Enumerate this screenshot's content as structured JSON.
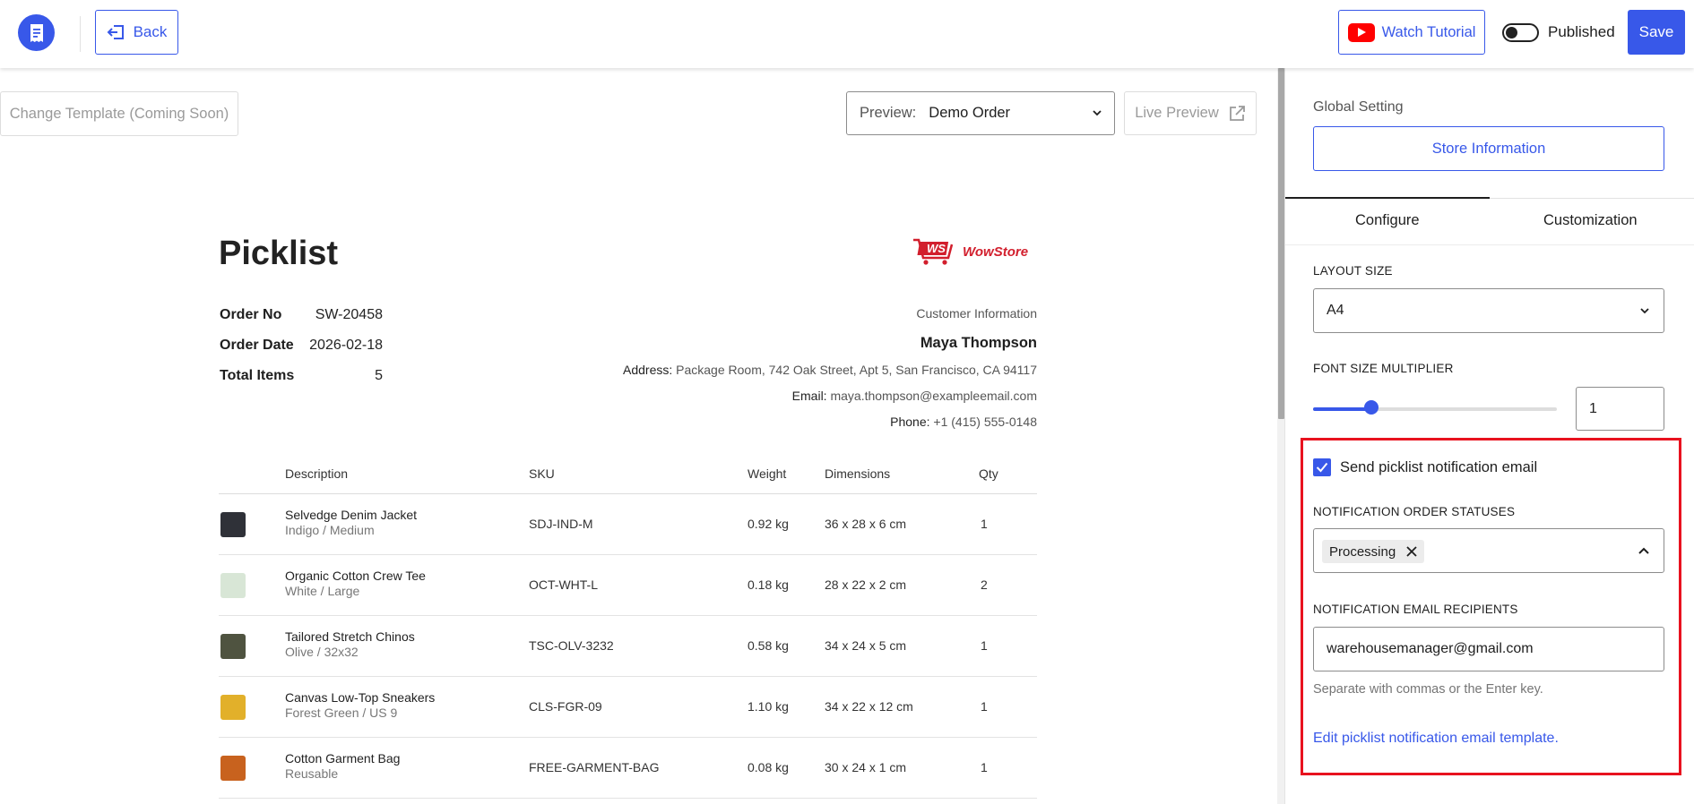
{
  "header": {
    "back_label": "Back",
    "watch_label": "Watch Tutorial",
    "published_label": "Published",
    "published_on": false,
    "save_label": "Save"
  },
  "toolbar": {
    "change_template_label": "Change Template (Coming Soon)",
    "preview_label": "Preview:",
    "preview_value": "Demo Order",
    "live_preview_label": "Live Preview"
  },
  "document": {
    "title": "Picklist",
    "brand_name": "WowStore",
    "brand_initials": "WS",
    "order": {
      "order_no_label": "Order No",
      "order_no": "SW-20458",
      "order_date_label": "Order Date",
      "order_date": "2026-02-18",
      "total_items_label": "Total Items",
      "total_items": "5"
    },
    "customer": {
      "heading": "Customer Information",
      "name": "Maya Thompson",
      "address_label": "Address:",
      "address": "Package Room, 742 Oak Street, Apt 5, San Francisco, CA 94117",
      "email_label": "Email:",
      "email": "maya.thompson@exampleemail.com",
      "phone_label": "Phone:",
      "phone": "+1 (415) 555-0148"
    },
    "table": {
      "headers": {
        "description": "Description",
        "sku": "SKU",
        "weight": "Weight",
        "dimensions": "Dimensions",
        "qty": "Qty"
      },
      "rows": [
        {
          "name": "Selvedge Denim Jacket",
          "variant": "Indigo / Medium",
          "sku": "SDJ-IND-M",
          "weight": "0.92 kg",
          "dimensions": "36 x 28 x 6 cm",
          "qty": "1",
          "thumb_color": "#2f3138"
        },
        {
          "name": "Organic Cotton Crew Tee",
          "variant": "White / Large",
          "sku": "OCT-WHT-L",
          "weight": "0.18 kg",
          "dimensions": "28 x 22 x 2 cm",
          "qty": "2",
          "thumb_color": "#d8e6d6"
        },
        {
          "name": "Tailored Stretch Chinos",
          "variant": "Olive / 32x32",
          "sku": "TSC-OLV-3232",
          "weight": "0.58 kg",
          "dimensions": "34 x 24 x 5 cm",
          "qty": "1",
          "thumb_color": "#4f5340"
        },
        {
          "name": "Canvas Low-Top Sneakers",
          "variant": "Forest Green / US 9",
          "sku": "CLS-FGR-09",
          "weight": "1.10 kg",
          "dimensions": "34 x 22 x 12 cm",
          "qty": "1",
          "thumb_color": "#e2b02a"
        },
        {
          "name": "Cotton Garment Bag",
          "variant": "Reusable",
          "sku": "FREE-GARMENT-BAG",
          "weight": "0.08 kg",
          "dimensions": "30 x 24 x 1 cm",
          "qty": "1",
          "thumb_color": "#c8621e"
        }
      ]
    }
  },
  "panel": {
    "global_setting_label": "Global Setting",
    "store_info_label": "Store Information",
    "tabs": {
      "configure": "Configure",
      "customization": "Customization",
      "active": "configure"
    },
    "layout_size_label": "LAYOUT SIZE",
    "layout_size_value": "A4",
    "font_size_label": "FONT SIZE MULTIPLIER",
    "font_size_value": "1",
    "font_size_slider_fraction": 0.24,
    "notify_checkbox_label": "Send picklist notification email",
    "notify_checked": true,
    "statuses_label": "NOTIFICATION ORDER STATUSES",
    "statuses": [
      "Processing"
    ],
    "recipients_label": "NOTIFICATION EMAIL RECIPIENTS",
    "recipients_value": "warehousemanager@gmail.com",
    "recipients_help": "Separate with commas or the Enter key.",
    "edit_template_link": "Edit picklist notification email template."
  },
  "colors": {
    "accent": "#3858e9",
    "highlight": "#e8121f",
    "brand_red": "#d21f2d"
  }
}
